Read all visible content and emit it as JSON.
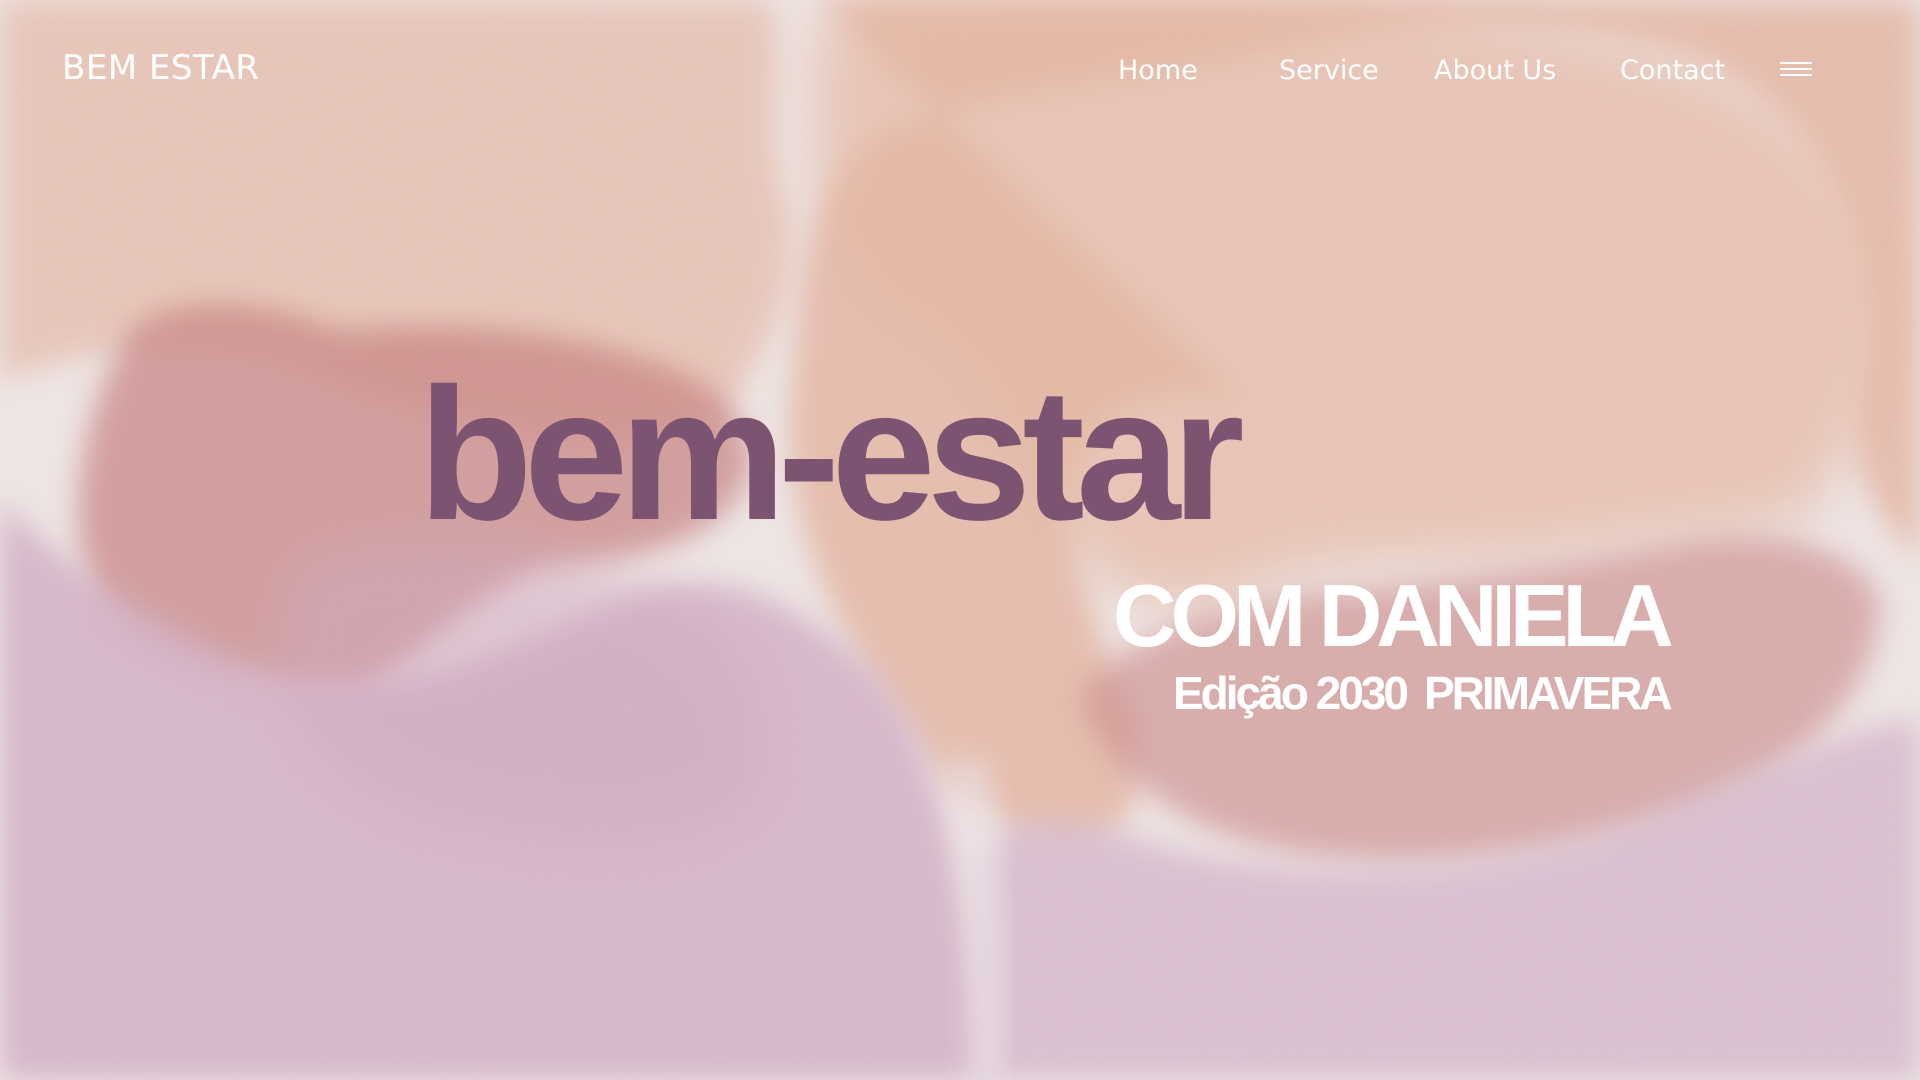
{
  "navbar": {
    "brand": "BEM ESTAR",
    "links": [
      "Home",
      "Service",
      "About Us",
      "Contact"
    ],
    "menu_icon": "hamburger-menu-icon"
  },
  "hero": {
    "title": "bem-estar",
    "name": "COM DANIELA",
    "edition": "Edição 2030",
    "season": "PRIMAVERA"
  },
  "colors": {
    "title": "#7c5371",
    "text_light": "#ffffff",
    "peach": "#e6b7a3",
    "rose": "#cf8e8d",
    "lilac": "#d7b6cb",
    "paper": "#f0e7e6"
  }
}
